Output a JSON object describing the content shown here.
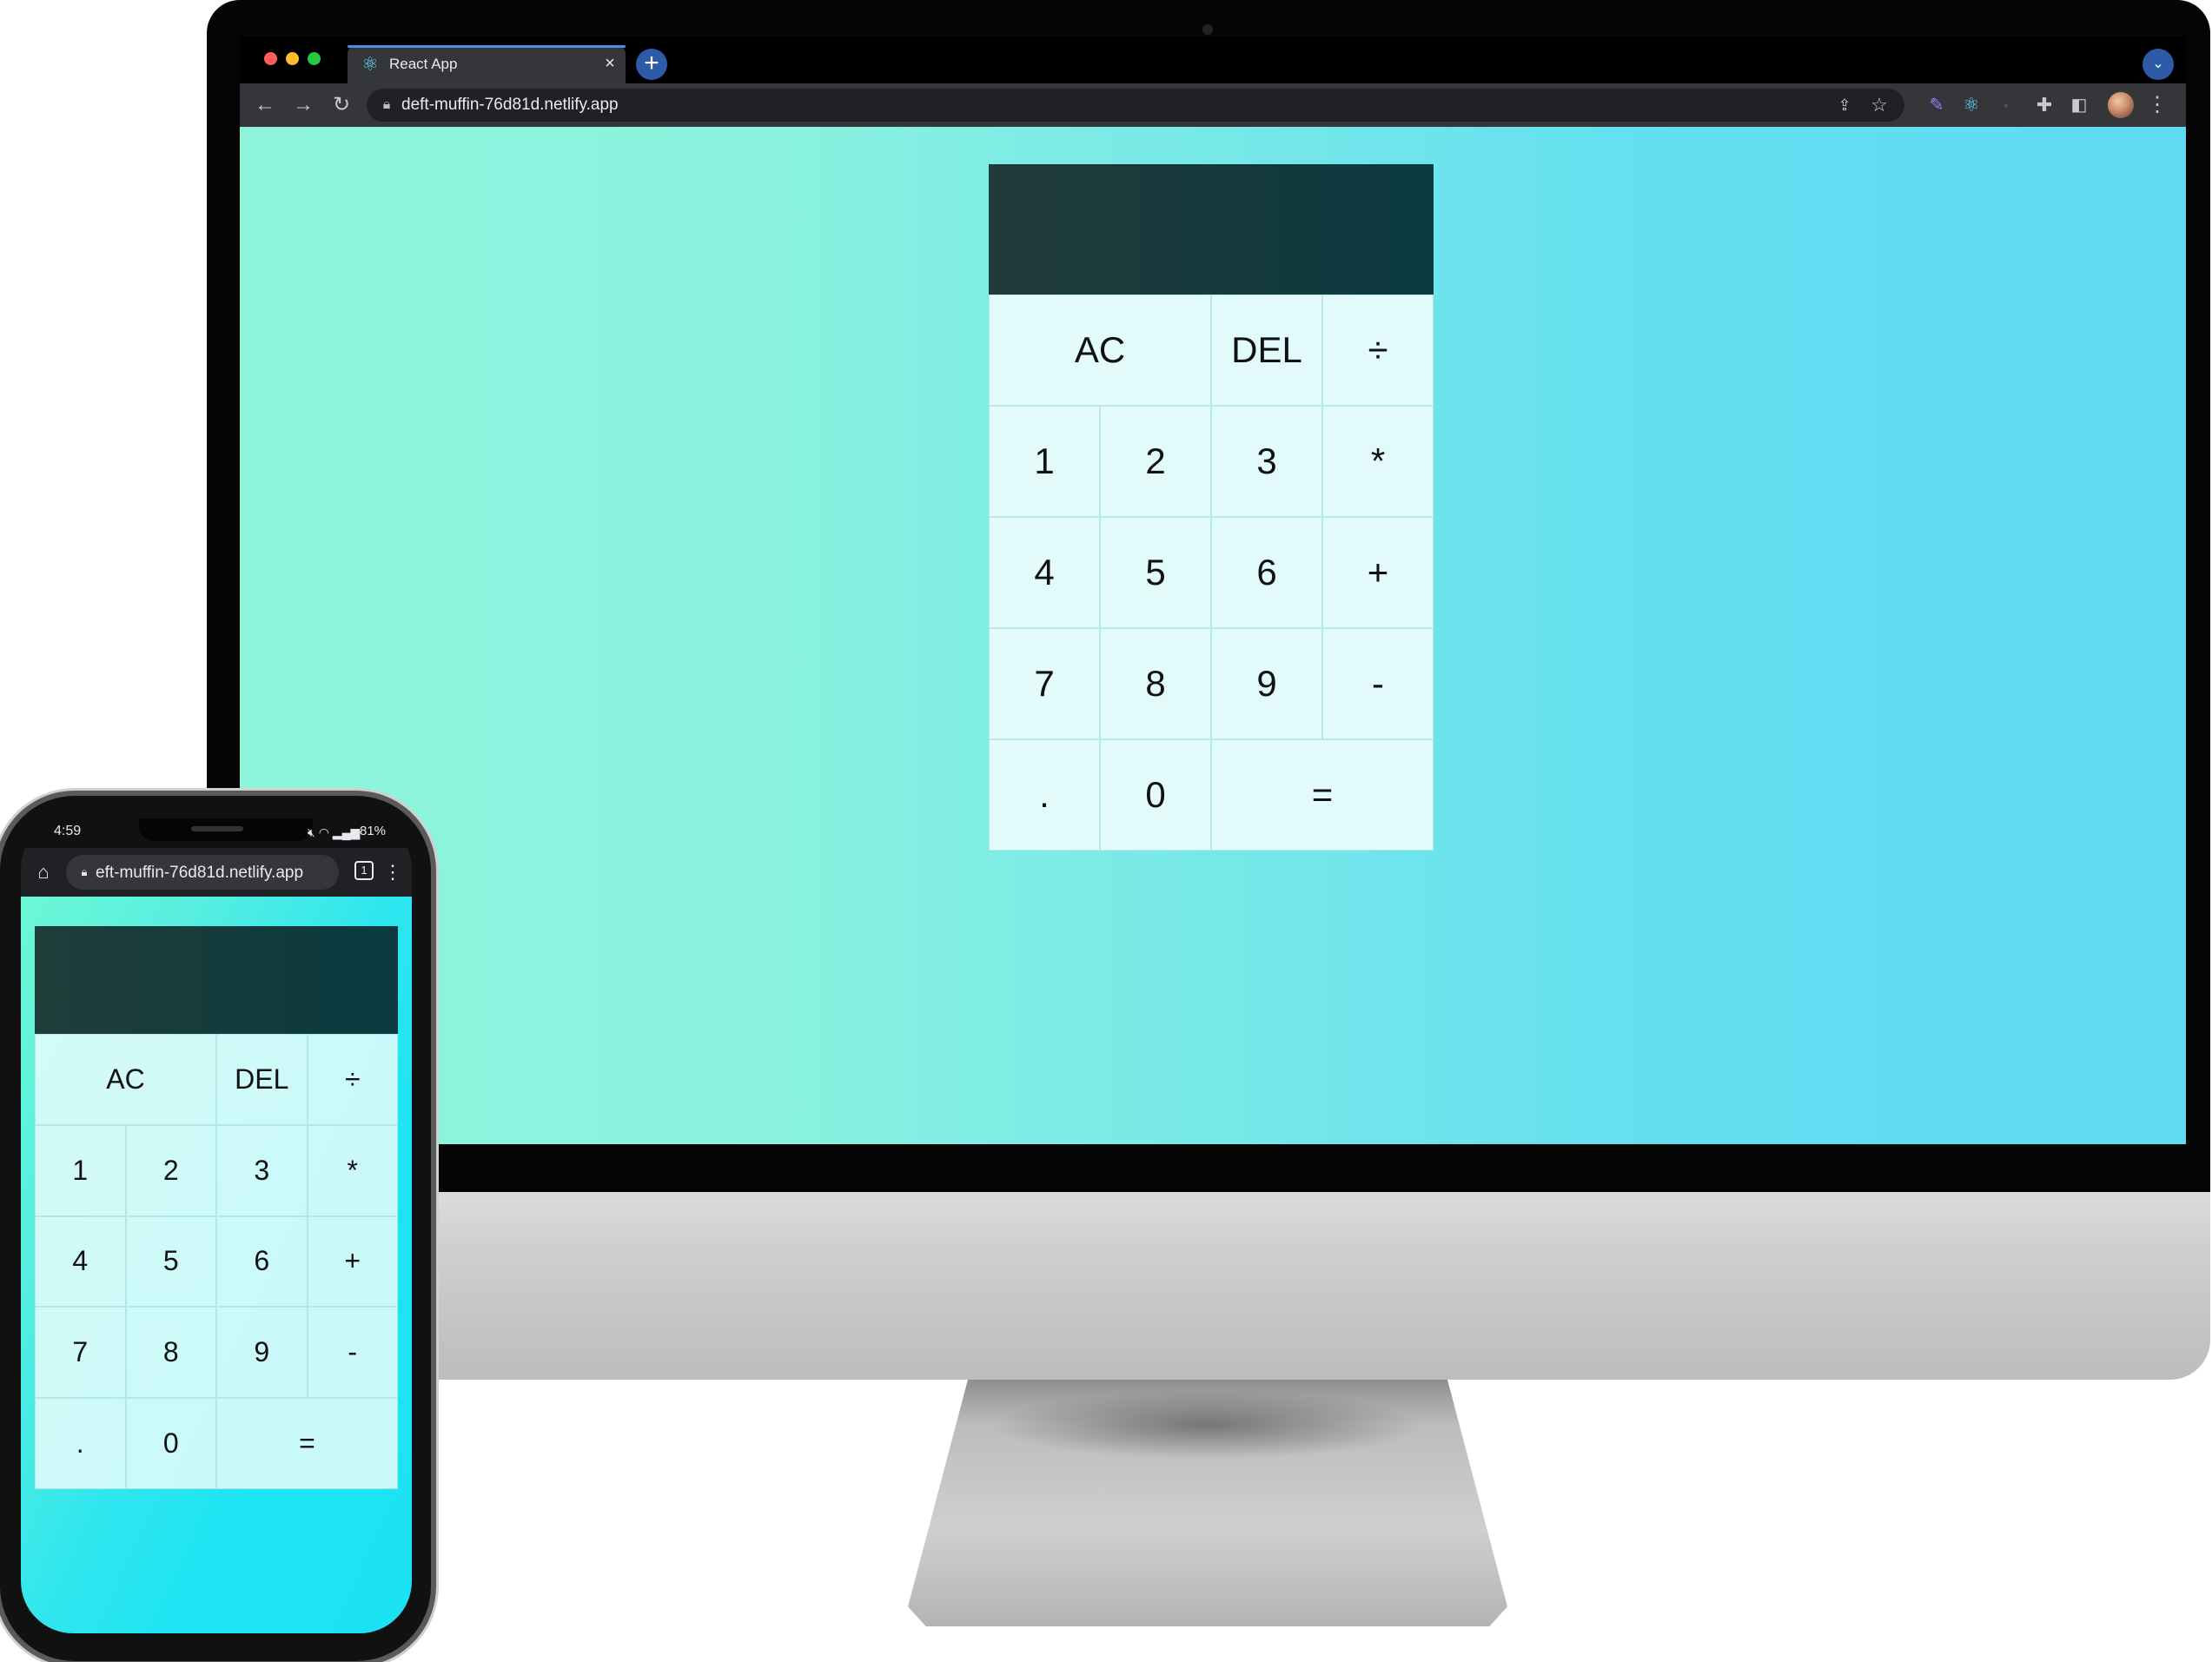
{
  "browser": {
    "tab_title": "React App",
    "tab_icon": "react-icon",
    "url": "deft-muffin-76d81d.netlify.app",
    "traffic_light_colors": [
      "#ff5f57",
      "#febc2e",
      "#28c840"
    ],
    "accent_color": "#4a90e2"
  },
  "calculator": {
    "display_value": "",
    "keys": [
      "AC",
      "DEL",
      "÷",
      "1",
      "2",
      "3",
      "*",
      "4",
      "5",
      "6",
      "+",
      "7",
      "8",
      "9",
      "-",
      ".",
      "0",
      "="
    ]
  },
  "phone": {
    "time": "4:59",
    "status_icons": "mute wifi signal",
    "battery": "81%",
    "url": "eft-muffin-76d81d.netlify.app",
    "tab_count": "1"
  }
}
